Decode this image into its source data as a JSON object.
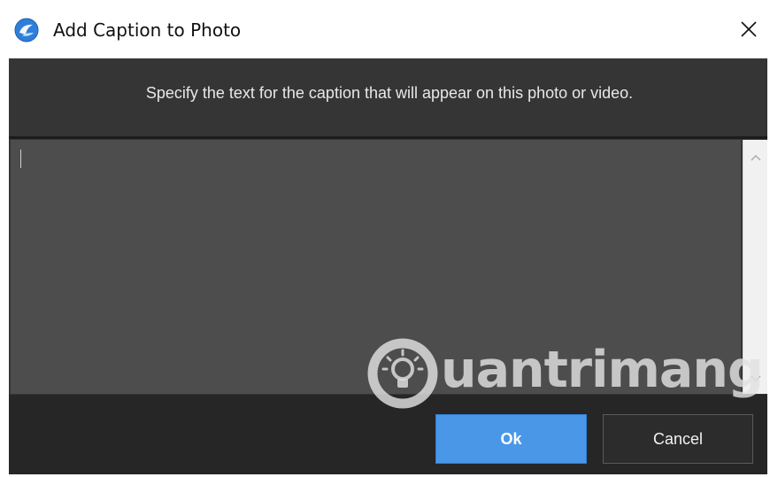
{
  "window": {
    "title": "Add Caption to Photo",
    "app_icon": "photo-app-icon",
    "close_icon": "close-icon"
  },
  "dialog": {
    "instructions": "Specify the text for the caption that will appear on this photo or video.",
    "caption_value": ""
  },
  "buttons": {
    "ok_label": "Ok",
    "cancel_label": "Cancel"
  },
  "watermark": {
    "text": "uantrimang",
    "icon": "lightbulb-icon"
  },
  "colors": {
    "dialog_bg": "#353535",
    "text_area_bg": "#4d4d4d",
    "button_bar_bg": "#262626",
    "ok_button": "#4a97e8"
  }
}
